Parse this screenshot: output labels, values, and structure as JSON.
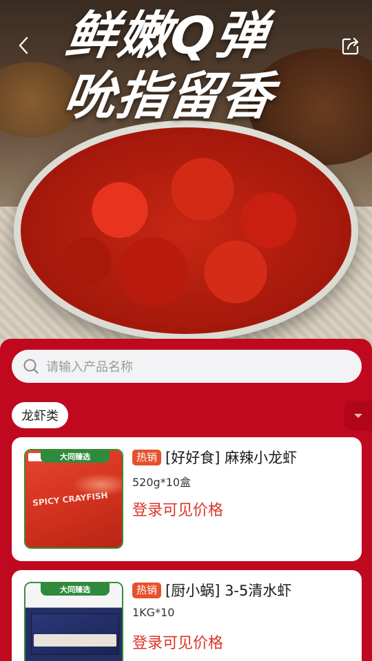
{
  "hero": {
    "title_line1": "鲜嫩Q弹",
    "title_line2": "吮指留香"
  },
  "nav": {
    "back_icon": "chevron-left-icon",
    "share_icon": "share-icon"
  },
  "search": {
    "placeholder": "请输入产品名称",
    "icon": "search-icon"
  },
  "category": {
    "selected": "龙虾类",
    "toggle_icon": "caret-down-icon"
  },
  "products": [
    {
      "badge": "热销",
      "name": "[好好食] 麻辣小龙虾",
      "spec": "520g*10盒",
      "price_hint": "登录可见价格",
      "thumb_tag": "大同臻选",
      "thumb_text": "SPICY CRAYFISH"
    },
    {
      "badge": "热销",
      "name": "[厨小蜗] 3-5清水虾",
      "spec": "1KG*10",
      "price_hint": "登录可见价格",
      "thumb_tag": "大同臻选"
    }
  ],
  "colors": {
    "brand_red": "#c0091f",
    "badge_orange": "#e5522c",
    "price_red": "#d8352b",
    "tag_green": "#2e8a3c"
  }
}
